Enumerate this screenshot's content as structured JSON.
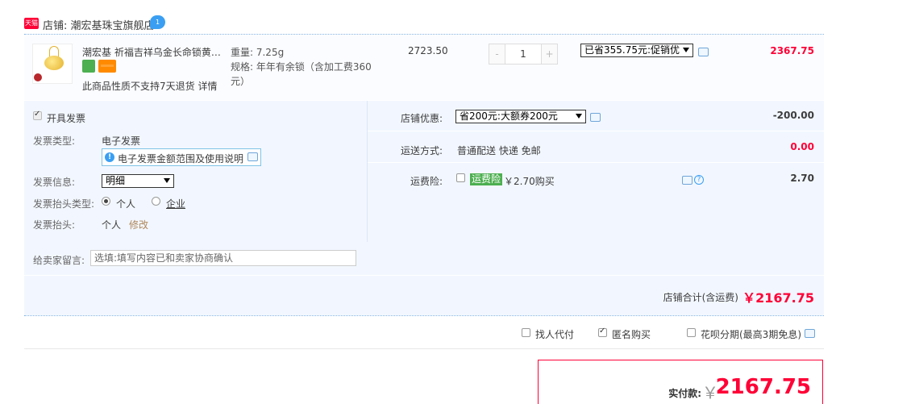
{
  "shop": {
    "badge": "天猫",
    "label": "店铺: 潮宏基珠宝旗舰店",
    "chat_badge": "1"
  },
  "item": {
    "title": "潮宏基 祈福吉祥乌金长命锁黄…",
    "note": "此商品性质不支持7天退货 详情",
    "weight": "重量: 7.25g",
    "spec": "规格: 年年有余锁（含加工费360元）",
    "unit_price": "2723.50",
    "qty_minus": "-",
    "qty_value": "1",
    "qty_plus": "+",
    "promo_selected": "已省355.75元:促销优",
    "subtotal": "2367.75"
  },
  "invoice": {
    "enable_label": "开具发票",
    "type_label": "发票类型:",
    "type_value": "电子发票",
    "tip": "电子发票金额范围及使用说明",
    "info_label": "发票信息:",
    "info_value": "明细",
    "title_type_label": "发票抬头类型:",
    "title_personal": "个人",
    "title_company": "企业",
    "title_label": "发票抬头:",
    "title_value": "个人",
    "modify": "修改"
  },
  "shop_discount": {
    "label": "店铺优惠:",
    "selected": "省200元:大额券200元",
    "amount": "-200.00"
  },
  "shipping": {
    "label": "运送方式:",
    "value": "普通配送 快递 免邮",
    "amount": "0.00"
  },
  "insurance": {
    "label": "运费险:",
    "tag": "运费险",
    "text": "￥2.70购买",
    "amount": "2.70"
  },
  "message": {
    "label": "给卖家留言:",
    "placeholder": "选填:填写内容已和卖家协商确认"
  },
  "shop_total": {
    "label": "店铺合计(含运费)",
    "value": "￥2167.75"
  },
  "options": {
    "proxy": "找人代付",
    "anonymous": "匿名购买",
    "installment": "花呗分期(最高3期免息)"
  },
  "payment": {
    "label": "实付款:",
    "yen": "￥",
    "value": "2167.75"
  },
  "colors": {
    "accent_red": "#ff0036",
    "panel_bg": "#f2f7ff",
    "link_blue": "#3a9ff2"
  }
}
